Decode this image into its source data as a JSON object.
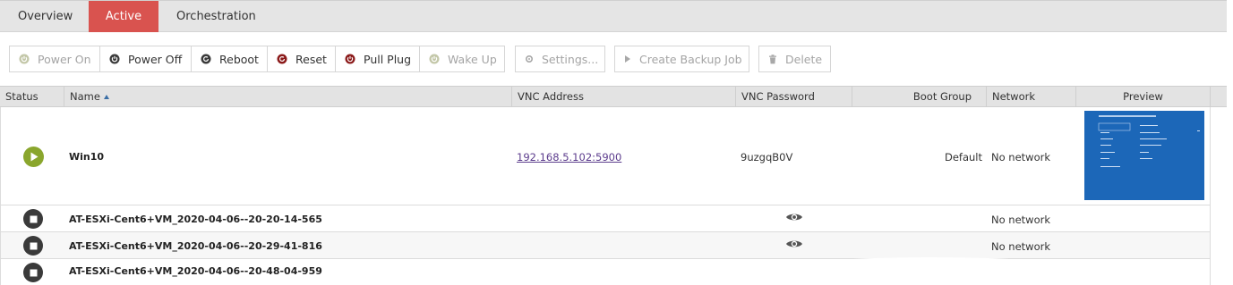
{
  "tabs": [
    {
      "label": "Overview"
    },
    {
      "label": "Active"
    },
    {
      "label": "Orchestration"
    }
  ],
  "toolbar": {
    "power_on": "Power On",
    "power_off": "Power Off",
    "reboot": "Reboot",
    "reset": "Reset",
    "pull_plug": "Pull Plug",
    "wake_up": "Wake Up",
    "settings": "Settings...",
    "create_backup_job": "Create Backup Job",
    "delete": "Delete"
  },
  "table": {
    "columns": [
      "Status",
      "Name",
      "VNC Address",
      "VNC Password",
      "Boot Group",
      "Network",
      "Preview"
    ],
    "rows": [
      {
        "status": "running",
        "name": "Win10",
        "vnc_address": "192.168.5.102:5900",
        "vnc_password": "9uzgqB0V",
        "boot_group": "Default",
        "network": "No network"
      },
      {
        "status": "stopped",
        "name": "AT-ESXi-Cent6+VM_2020-04-06--20-20-14-565",
        "vnc_address": "",
        "vnc_password": "",
        "boot_group": "",
        "network": "No network"
      },
      {
        "status": "stopped",
        "name": "AT-ESXi-Cent6+VM_2020-04-06--20-29-41-816",
        "vnc_address": "",
        "vnc_password": "",
        "boot_group": "",
        "network": "No network"
      },
      {
        "status": "stopped",
        "name": "AT-ESXi-Cent6+VM_2020-04-06--20-48-04-959",
        "vnc_address": "",
        "vnc_password": "",
        "boot_group": "",
        "network": ""
      }
    ]
  },
  "colors": {
    "active_tab": "#d9534f",
    "running_status": "#8aa62d",
    "stopped_status": "#3a3a3a",
    "preview_bg": "#1c67b8"
  },
  "icons": {
    "power_on": "power-icon",
    "power_off": "power-icon",
    "reboot": "reboot-icon",
    "reset": "reset-icon",
    "pull_plug": "plug-icon",
    "wake_up": "power-icon",
    "settings": "gear-icon",
    "create_backup_job": "play-icon",
    "delete": "trash-icon",
    "password": "eye-icon"
  }
}
